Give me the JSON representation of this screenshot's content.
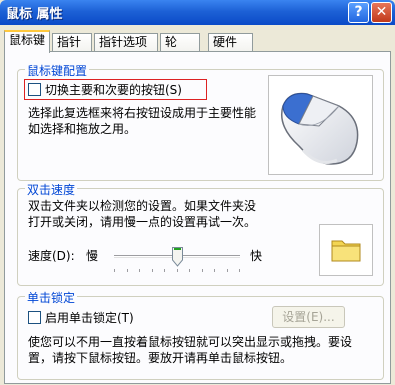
{
  "window": {
    "title": "鼠标 属性"
  },
  "titlebar_buttons": {
    "help": "?",
    "close": "✕"
  },
  "tabs": [
    "鼠标键",
    "指针",
    "指针选项",
    "轮",
    "硬件"
  ],
  "button_config": {
    "group_title": "鼠标键配置",
    "switch_label": "切换主要和次要的按钮(S)",
    "description_line1": "选择此复选框来将右按钮设成用于主要性能",
    "description_line2": "如选择和拖放之用。"
  },
  "double_click": {
    "group_title": "双击速度",
    "description_line1": "双击文件夹以检测您的设置。如果文件夹没",
    "description_line2": "打开或关闭，请用慢一点的设置再试一次。",
    "speed_label": "速度(D):",
    "slow_label": "慢",
    "fast_label": "快",
    "speed_level": 0.5
  },
  "click_lock": {
    "group_title": "单击锁定",
    "enable_label": "启用单击锁定(T)",
    "settings_button": "设置(E)...",
    "description_line1": "使您可以不用一直按着鼠标按钮就可以突出显示或拖拽。要设",
    "description_line2": "置，请按下鼠标按钮。要放开请再单击鼠标按钮。"
  },
  "colors": {
    "titlebar": "#0a4ac7",
    "group_title": "#0046d5",
    "highlight": "#dd2222",
    "tab_active_accent": "#ffc83c"
  },
  "icons": {
    "mouse": "mouse-illustration-icon",
    "folder": "folder-icon",
    "help": "help-icon",
    "close": "close-icon"
  }
}
